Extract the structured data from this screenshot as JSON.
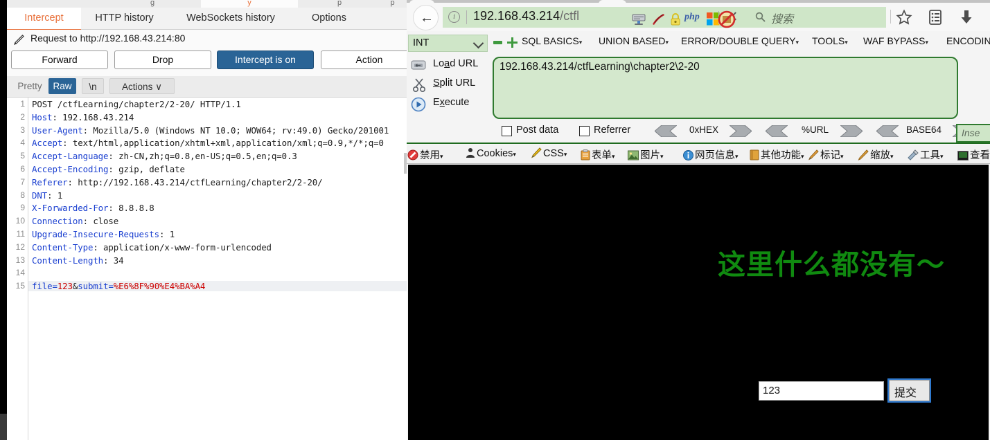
{
  "burp": {
    "top_tabs": [
      "g",
      "y",
      "p",
      "p"
    ],
    "tabs": [
      {
        "label": "Intercept",
        "active": true
      },
      {
        "label": "HTTP history",
        "active": false
      },
      {
        "label": "WebSockets history",
        "active": false
      },
      {
        "label": "Options",
        "active": false
      }
    ],
    "request_line": "Request to http://192.168.43.214:80",
    "buttons": [
      {
        "label": "Forward",
        "primary": false
      },
      {
        "label": "Drop",
        "primary": false
      },
      {
        "label": "Intercept is on",
        "primary": true
      },
      {
        "label": "Action",
        "primary": false
      }
    ],
    "view_buttons": [
      {
        "label": "Pretty",
        "state": "plain"
      },
      {
        "label": "Raw",
        "state": "selected"
      },
      {
        "label": "\\n",
        "state": "box"
      },
      {
        "label": "Actions ∨",
        "state": "box"
      }
    ],
    "request_lines": [
      {
        "n": 1,
        "text": "POST /ctfLearning/chapter2/2-20/ HTTP/1.1",
        "kind": "plain"
      },
      {
        "n": 2,
        "key": "Host",
        "text": ": 192.168.43.214",
        "kind": "header"
      },
      {
        "n": 3,
        "key": "User-Agent",
        "text": ": Mozilla/5.0 (Windows NT 10.0; WOW64; rv:49.0) Gecko/201001",
        "kind": "header"
      },
      {
        "n": 4,
        "key": "Accept",
        "text": ": text/html,application/xhtml+xml,application/xml;q=0.9,*/*;q=0",
        "kind": "header"
      },
      {
        "n": 5,
        "key": "Accept-Language",
        "text": ": zh-CN,zh;q=0.8,en-US;q=0.5,en;q=0.3",
        "kind": "header"
      },
      {
        "n": 6,
        "key": "Accept-Encoding",
        "text": ": gzip, deflate",
        "kind": "header"
      },
      {
        "n": 7,
        "key": "Referer",
        "text": ": http://192.168.43.214/ctfLearning/chapter2/2-20/",
        "kind": "header"
      },
      {
        "n": 8,
        "key": "DNT",
        "text": ": 1",
        "kind": "header"
      },
      {
        "n": 9,
        "key": "X-Forwarded-For",
        "text": ": 8.8.8.8",
        "kind": "header"
      },
      {
        "n": 10,
        "key": "Connection",
        "text": ": close",
        "kind": "header"
      },
      {
        "n": 11,
        "key": "Upgrade-Insecure-Requests",
        "text": ": 1",
        "kind": "header"
      },
      {
        "n": 12,
        "key": "Content-Type",
        "text": ": application/x-www-form-urlencoded",
        "kind": "header"
      },
      {
        "n": 13,
        "key": "Content-Length",
        "text": ": 34",
        "kind": "header"
      },
      {
        "n": 14,
        "text": "",
        "kind": "plain"
      },
      {
        "n": 15,
        "text": "",
        "kind": "body"
      }
    ],
    "body_parts": {
      "p1": "file=",
      "p2": "123",
      "p3": "&",
      "p4": "submit=",
      "p5": "%E6%8F%90%E4%BA%A4"
    }
  },
  "browser": {
    "back_arrow": "←",
    "info_char": "i",
    "url_main": "192.168.43.214",
    "url_path": "/ctfl",
    "url_icons": [
      "server-icon",
      "apache-feather-icon",
      "lock-icon",
      "php-icon",
      "windows-icon"
    ],
    "php_label": "php",
    "close_char": "✕",
    "search_placeholder": "搜索",
    "nav_icons": [
      "star-icon",
      "reader-list-icon",
      "download-icon",
      "home-icon",
      "globe-icon"
    ]
  },
  "hackbar": {
    "select_value": "INT",
    "menus": [
      {
        "label": "SQL BASICS",
        "caret": "▾"
      },
      {
        "label": "UNION BASED",
        "caret": "▾"
      },
      {
        "label": "ERROR/DOUBLE QUERY",
        "caret": "▾"
      },
      {
        "label": "TOOLS",
        "caret": "▾"
      },
      {
        "label": "WAF BYPASS",
        "caret": "▾"
      },
      {
        "label": "ENCODIN",
        "caret": ""
      }
    ],
    "actions": [
      {
        "pre": "Lo",
        "u": "a",
        "post": "d URL"
      },
      {
        "pre": "",
        "u": "S",
        "post": "plit URL"
      },
      {
        "pre": "E",
        "u": "x",
        "post": "ecute"
      }
    ],
    "url_value": "192.168.43.214/ctfLearning\\chapter2\\2-20",
    "checkboxes": [
      {
        "label": "Post data",
        "checked": false
      },
      {
        "label": "Referrer",
        "checked": false
      }
    ],
    "encoders": [
      "0xHEX",
      "%URL",
      "BASE64"
    ],
    "insert_label": "Inse"
  },
  "webdev_toolbar": [
    {
      "label": "禁用",
      "icon": "disable-icon",
      "caret": "▾"
    },
    {
      "label": "Cookies",
      "icon": "cookies-icon",
      "caret": "▾"
    },
    {
      "label": "CSS",
      "icon": "css-icon",
      "caret": "▾"
    },
    {
      "label": "表单",
      "icon": "forms-icon",
      "caret": "▾"
    },
    {
      "label": "图片",
      "icon": "images-icon",
      "caret": "▾"
    },
    {
      "label": "网页信息",
      "icon": "information-icon",
      "caret": "▾"
    },
    {
      "label": "其他功能",
      "icon": "misc-icon",
      "caret": "▾"
    },
    {
      "label": "标记",
      "icon": "outline-icon",
      "caret": "▾"
    },
    {
      "label": "缩放",
      "icon": "resize-icon",
      "caret": "▾"
    },
    {
      "label": "工具",
      "icon": "tools-icon",
      "caret": "▾"
    },
    {
      "label": "查看源",
      "icon": "view-source-icon",
      "caret": ""
    }
  ],
  "page": {
    "message": "这里什么都没有～",
    "message_color": "#108a10",
    "background_color": "#000000",
    "input_value": "123",
    "submit_label": "提交"
  }
}
